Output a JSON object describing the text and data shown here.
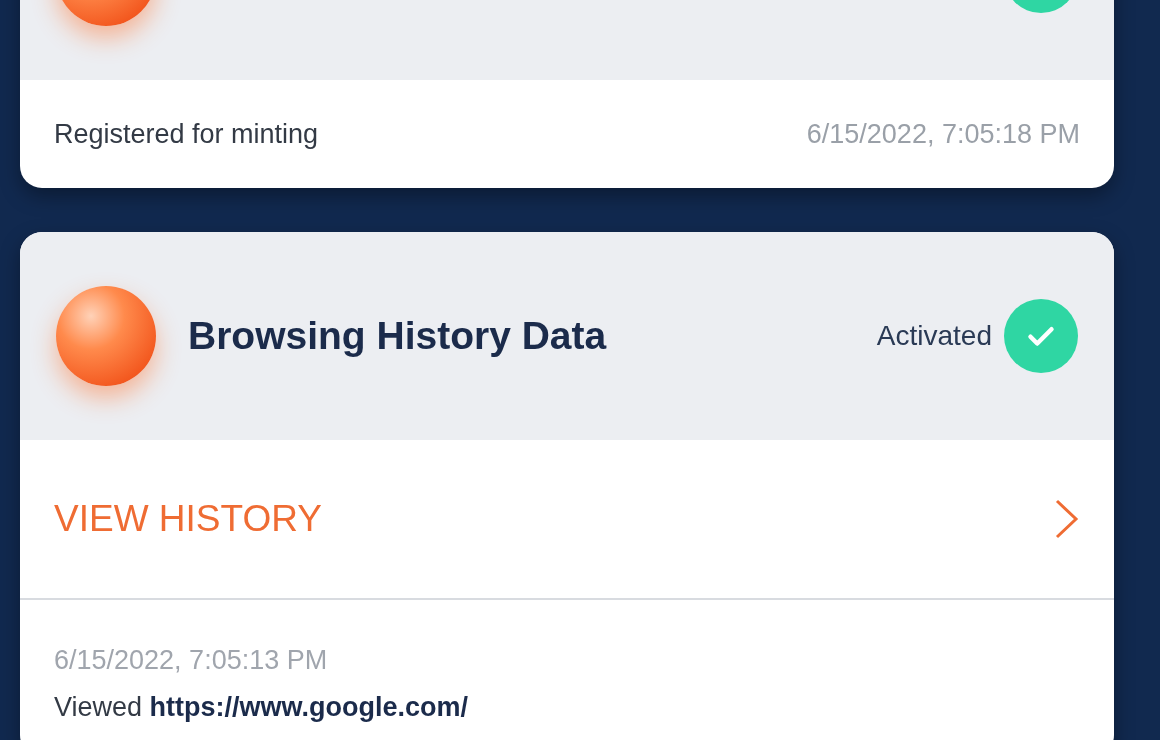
{
  "cards": [
    {
      "activated": true,
      "footer": {
        "note": "Registered for minting",
        "time": "6/15/2022, 7:05:18 PM"
      }
    },
    {
      "title": "Browsing History Data",
      "status": "Activated",
      "activated": true,
      "link": "VIEW HISTORY",
      "history": [
        {
          "time": "6/15/2022, 7:05:13 PM",
          "text": "Viewed **https://www.google.com/**"
        }
      ]
    }
  ]
}
